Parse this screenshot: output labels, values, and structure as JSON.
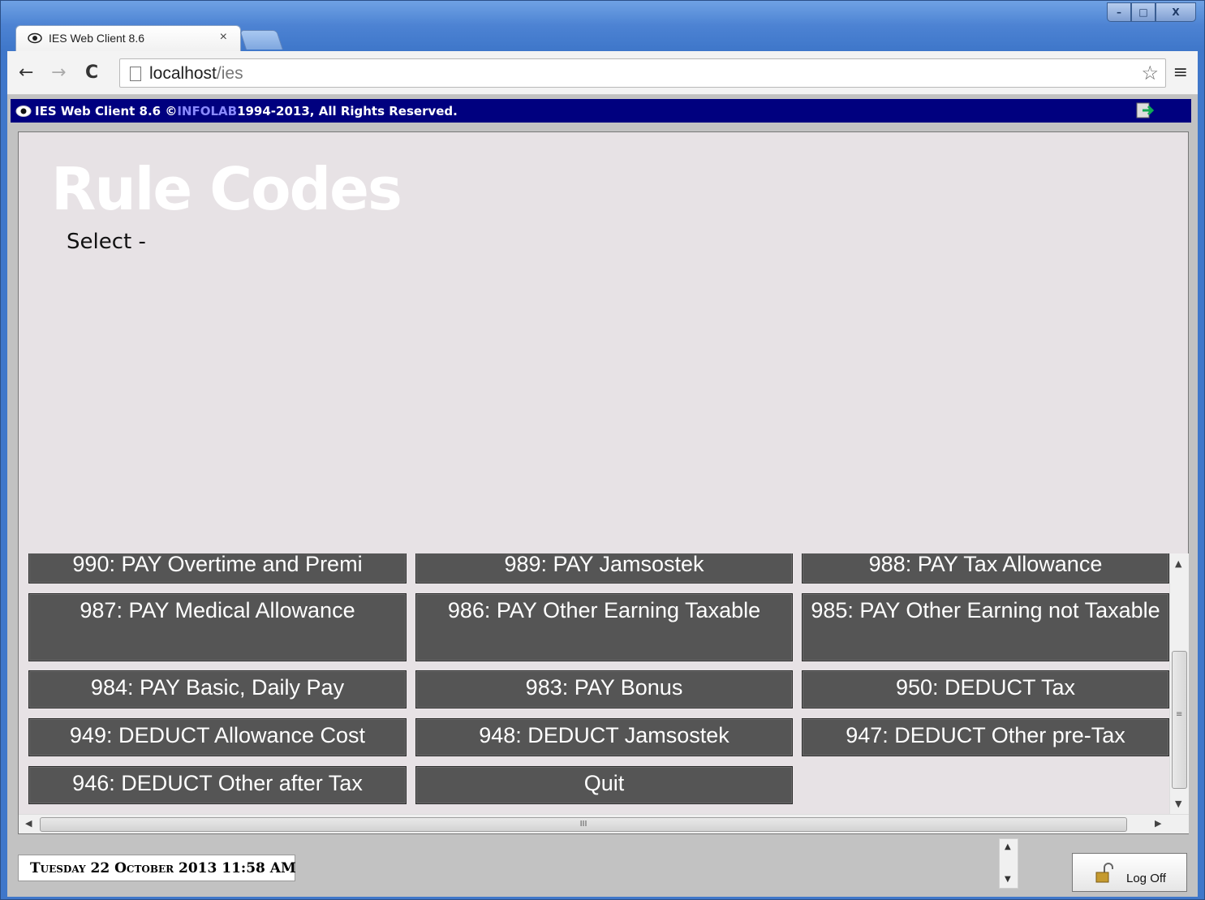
{
  "browser": {
    "tab_title": "IES Web Client 8.6",
    "tab_close": "×",
    "url_host": "localhost",
    "url_path": "/ies",
    "window_buttons": {
      "minimize": "–",
      "maximize": "□",
      "close": "X"
    },
    "icons": {
      "back": "←",
      "forward": "→",
      "reload": "C",
      "star": "☆",
      "menu": "≡"
    }
  },
  "app_bar": {
    "prefix": "IES Web Client 8.6 © ",
    "brand": "INFOLAB",
    "suffix": " 1994-2013, All Rights Reserved.",
    "brand_color": "#8a8aff",
    "bar_color": "#00007f"
  },
  "page": {
    "title": "Rule Codes",
    "subtitle": "Select -"
  },
  "rule_buttons": [
    "990: PAY Overtime and Premi",
    "989: PAY Jamsostek",
    "988: PAY Tax Allowance",
    "987: PAY Medical Allowance",
    "986: PAY Other Earning Taxable",
    "985: PAY Other Earning not Taxable",
    "984: PAY Basic, Daily Pay",
    "983: PAY Bonus",
    "950: DEDUCT Tax",
    "949: DEDUCT Allowance Cost",
    "948: DEDUCT Jamsostek",
    "947: DEDUCT Other pre-Tax",
    "946: DEDUCT Other after Tax",
    "Quit"
  ],
  "scroll": {
    "up": "▲",
    "down": "▼",
    "left": "◀",
    "right": "▶",
    "grip_h": "III",
    "grip_v": "≡"
  },
  "status": {
    "datetime": "Tuesday 22 October 2013 11:58 AM",
    "logoff": "Log Off"
  },
  "colors": {
    "button_bg": "#555555",
    "panel_bg": "#e7e2e5",
    "title_color": "#ffffff"
  }
}
